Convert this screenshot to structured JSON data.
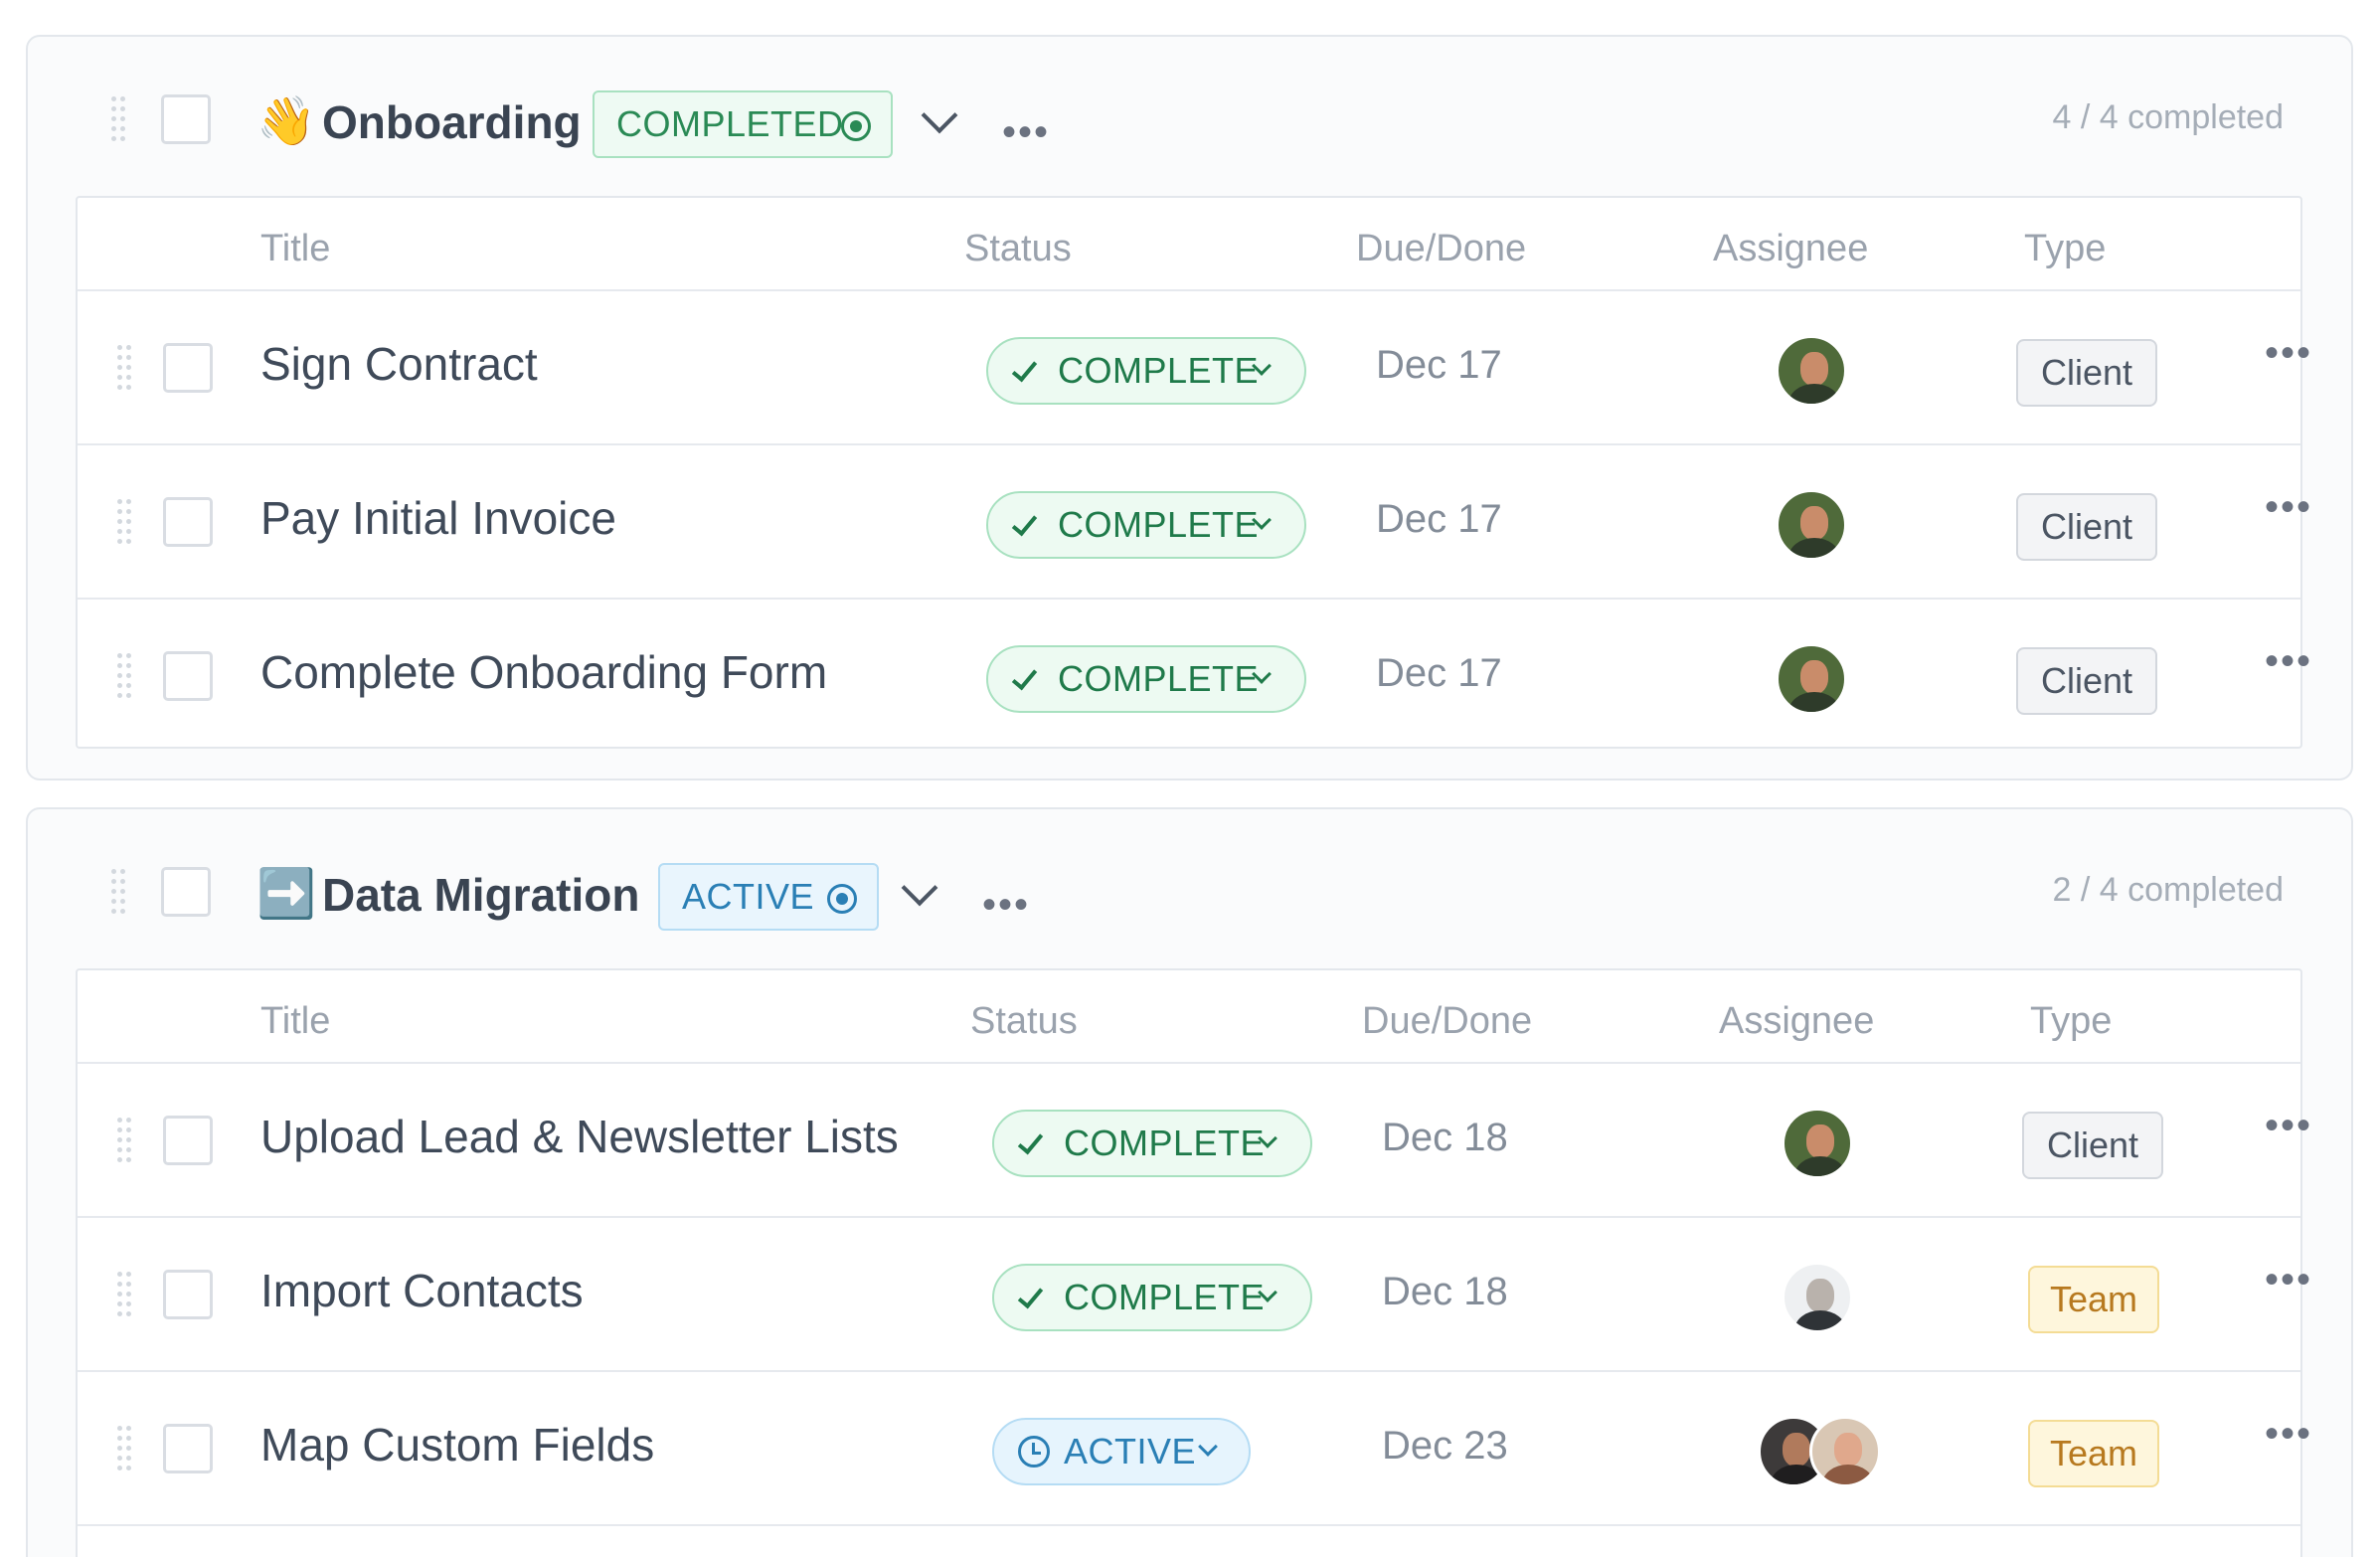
{
  "sections": [
    {
      "emoji": "👋",
      "title": "Onboarding",
      "state_label": "COMPLETED",
      "progress": "4 / 4 completed",
      "columns": [
        "Title",
        "Status",
        "Due/Done",
        "Assignee",
        "Type"
      ],
      "tasks": [
        {
          "title": "Sign Contract",
          "status": "COMPLETE",
          "due": "Dec 17",
          "type": "Client"
        },
        {
          "title": "Pay Initial Invoice",
          "status": "COMPLETE",
          "due": "Dec 17",
          "type": "Client"
        },
        {
          "title": "Complete Onboarding Form",
          "status": "COMPLETE",
          "due": "Dec 17",
          "type": "Client"
        }
      ]
    },
    {
      "emoji": "➡️",
      "title": "Data Migration",
      "state_label": "ACTIVE",
      "progress": "2 / 4 completed",
      "columns": [
        "Title",
        "Status",
        "Due/Done",
        "Assignee",
        "Type"
      ],
      "tasks": [
        {
          "title": "Upload Lead & Newsletter Lists",
          "status": "COMPLETE",
          "due": "Dec 18",
          "type": "Client"
        },
        {
          "title": "Import Contacts",
          "status": "COMPLETE",
          "due": "Dec 18",
          "type": "Team"
        },
        {
          "title": "Map Custom Fields",
          "status": "ACTIVE",
          "due": "Dec 23",
          "type": "Team"
        }
      ]
    }
  ],
  "colors": {
    "complete_green": "#1f7a4a",
    "active_blue": "#2a7fb5",
    "team_amber": "#b7791f"
  }
}
